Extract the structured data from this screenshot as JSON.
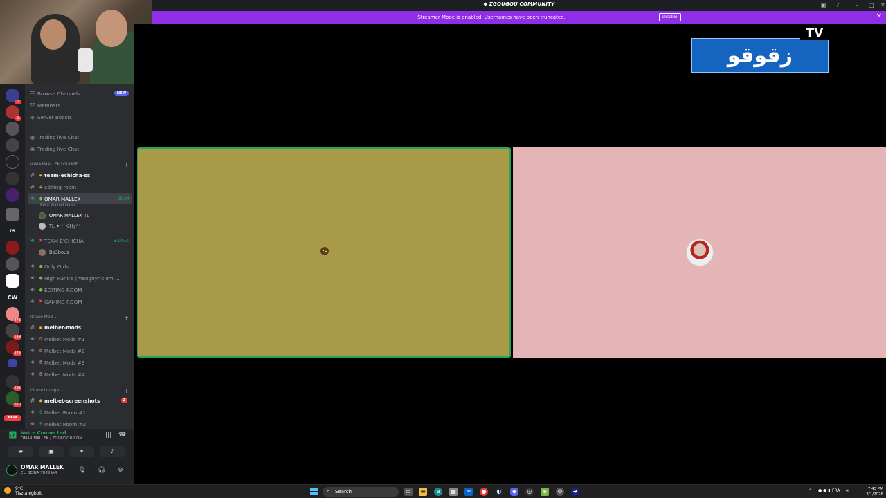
{
  "window": {
    "title": "ZGOUGOU COMMUNITY"
  },
  "banner": {
    "message": "Streamer Mode is enabled. Usernames have been truncated.",
    "disable_label": "Disable"
  },
  "rail": {
    "text_rs": "rs",
    "text_cw": "CW",
    "new_label": "NEW",
    "badges": [
      "2",
      "1",
      "",
      "",
      "",
      "",
      "",
      "",
      "",
      "",
      "",
      "",
      "373",
      "149",
      "348",
      "292",
      "370",
      ""
    ]
  },
  "sidebar": {
    "top_items": [
      {
        "label": "Browse Channels",
        "pill": "NEW"
      },
      {
        "label": "Members"
      },
      {
        "label": "Server Boosts"
      },
      {
        "label": "Trading live Chat"
      },
      {
        "label": "Trading live Chat"
      }
    ],
    "categories": [
      "IOMARMALLEK LOUNGE",
      "IStake Mod",
      "IStake Lounge"
    ],
    "channels": [
      {
        "label": "team-echicha-ss"
      },
      {
        "label": "editing-room"
      },
      {
        "label": "OMAR MALLEK",
        "time": "55:34"
      },
      {
        "label": "TEAM E'CHICHA",
        "time": "6:14:50"
      },
      {
        "label": "Only Girls"
      },
      {
        "label": "High Rank's (menghyr klem ..."
      },
      {
        "label": "EDITING ROOM"
      },
      {
        "label": "GAMING ROOM"
      },
      {
        "label": "melbet-mods"
      },
      {
        "label": "Melbet Mods #1"
      },
      {
        "label": "Melbet Mods #2"
      },
      {
        "label": "Melbet Mods #3"
      },
      {
        "label": "Melbet Mods #4"
      },
      {
        "label": "melbet-screenshots",
        "badge": "2"
      },
      {
        "label": "Melbet Room #1"
      },
      {
        "label": "Melbet Room #2"
      }
    ],
    "status_note": "Set a channel status",
    "voice_users": [
      {
        "name": "OMAR MALLEK",
        "tag": "TL"
      },
      {
        "name": "TL ✦ ᵒ⁺Kittyᵒ⁺"
      },
      {
        "name": "Ba3bous"
      }
    ]
  },
  "voice_panel": {
    "status": "Voice Connected",
    "channel": "OMAR MALLEK / ZGOUGOU COM..."
  },
  "user": {
    "name": "OMAR MALLEK",
    "status": "ELI BEJNA YJI NHAR"
  },
  "stage": {
    "logo_text": "زقوقو",
    "logo_tv": "TV"
  },
  "taskbar": {
    "temp": "9°C",
    "weather": "Tiszta égbolt",
    "search": "Search",
    "lang": "FRA",
    "time": "7:43 PM",
    "date": "3/1/2026"
  },
  "colors": {
    "accent": "#8f2ee6",
    "online": "#23a55a",
    "tile1": "#a99a48",
    "tile2": "#e5b4b6",
    "blurple": "#5865f2"
  }
}
